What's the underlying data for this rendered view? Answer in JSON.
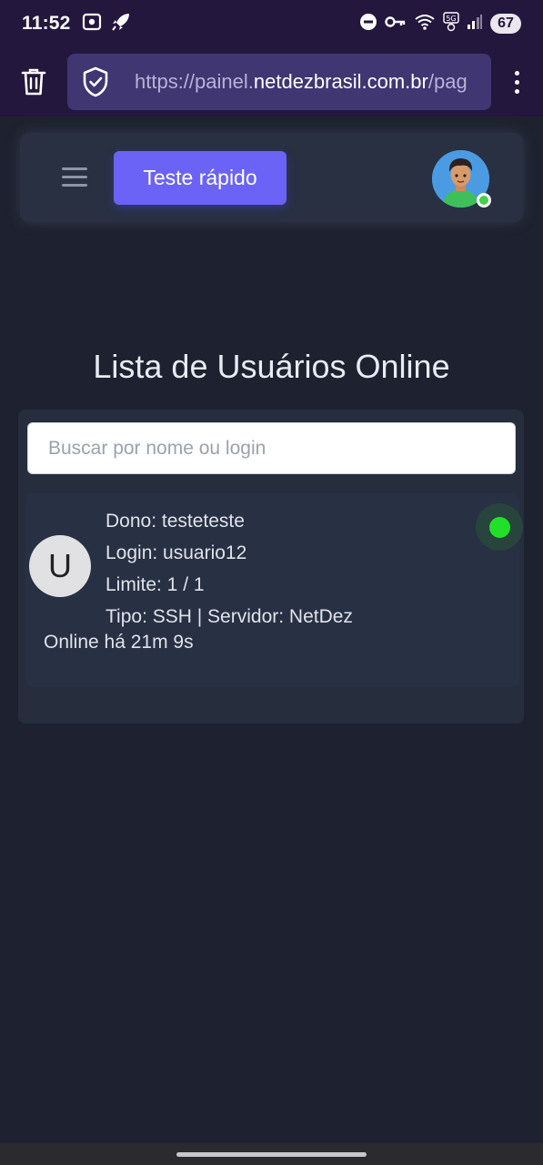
{
  "status_bar": {
    "time": "11:52",
    "battery": "67",
    "left_icons": [
      "screen-record-icon",
      "rocket-icon"
    ],
    "right_icons": [
      "do-not-disturb-icon",
      "vpn-key-icon",
      "wifi-icon",
      "5g-icon",
      "signal-icon"
    ]
  },
  "browser": {
    "url_prefix": "https://painel.",
    "url_host": "netdezbrasil.com.br",
    "url_suffix": "/pag"
  },
  "header": {
    "quick_test_label": "Teste rápido"
  },
  "page": {
    "title": "Lista de Usuários Online"
  },
  "search": {
    "placeholder": "Buscar por nome ou login",
    "value": ""
  },
  "users": [
    {
      "initial": "U",
      "owner": "Dono: testeteste",
      "login": "Login: usuario12",
      "limit": "Limite: 1 / 1",
      "type_server": "Tipo: SSH | Servidor: NetDez",
      "online_time": "Online há 21m 9s",
      "status_color": "#22e02a"
    }
  ],
  "colors": {
    "background": "#1e2230",
    "card": "#283042",
    "accent": "#6b63f5",
    "online": "#22e02a"
  }
}
